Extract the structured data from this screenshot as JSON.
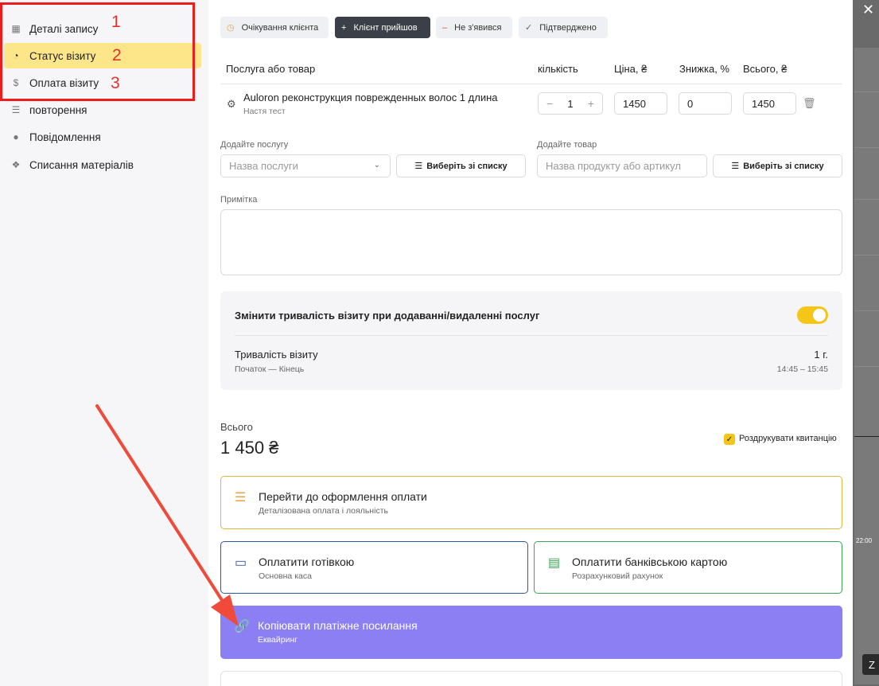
{
  "sidebar": {
    "items": [
      {
        "label": "Деталі запису",
        "icon": "calendar-icon"
      },
      {
        "label": "Статус візиту",
        "icon": "clock-icon"
      },
      {
        "label": "Оплата візиту",
        "icon": "dollar-icon"
      },
      {
        "label": "повторення",
        "icon": "list-icon"
      },
      {
        "label": "Повідомлення",
        "icon": "chat-icon"
      },
      {
        "label": "Списання матеріалів",
        "icon": "materials-icon"
      }
    ],
    "annotations": [
      "1",
      "2",
      "3"
    ]
  },
  "status_buttons": [
    {
      "label": "Очікування клієнта"
    },
    {
      "label": "Клієнт прийшов"
    },
    {
      "label": "Не з'явився"
    },
    {
      "label": "Підтверджено"
    }
  ],
  "table": {
    "headers": [
      "Послуга або товар",
      "кількість",
      "Ціна, ₴",
      "Знижка, %",
      "Всього, ₴"
    ],
    "row": {
      "name": "Auloron реконструкция поврежденных волос 1 длина",
      "master": "Настя тест",
      "qty": "1",
      "price": "1450",
      "discount": "0",
      "total": "1450"
    }
  },
  "add_service": {
    "label": "Додайте послугу",
    "placeholder": "Назва послуги",
    "list_button": "Виберіть зі списку"
  },
  "add_product": {
    "label": "Додайте товар",
    "placeholder": "Назва продукту або артикул",
    "list_button": "Виберіть зі списку"
  },
  "note": {
    "label": "Примітка"
  },
  "duration": {
    "toggle_label": "Змінити тривалість візиту при додаванні/видаленні послуг",
    "toggle_on": true,
    "title": "Тривалість візиту",
    "subtitle": "Початок — Кінець",
    "value": "1 г.",
    "range": "14:45 – 15:45"
  },
  "summary": {
    "label": "Всього",
    "amount": "1 450 ₴",
    "print_receipt": "Роздрукувати квитанцію",
    "print_checked": true
  },
  "payments": [
    {
      "title": "Перейти до оформлення оплати",
      "subtitle": "Деталізована оплата і лояльність",
      "color": "#e0b83a"
    },
    {
      "title": "Оплатити готівкою",
      "subtitle": "Основна каса",
      "color": "#2f55a4"
    },
    {
      "title": "Оплатити банківською картою",
      "subtitle": "Розрахунковий рахунок",
      "color": "#3aa655"
    },
    {
      "title": "Копіювати платіжне посилання",
      "subtitle": "Еквайринг",
      "color": "#8b7ff3"
    }
  ],
  "background": {
    "time_label": "22:00",
    "close": "✕",
    "z_button": "Z"
  }
}
